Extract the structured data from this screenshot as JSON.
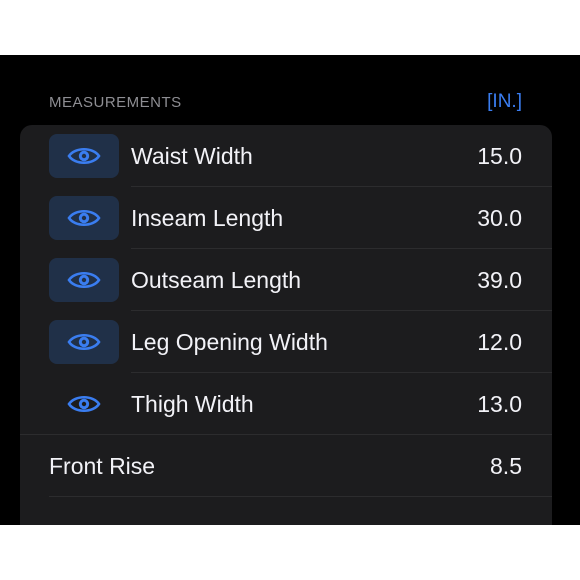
{
  "section": {
    "title": "MEASUREMENTS",
    "unit_label": "[IN.]"
  },
  "colors": {
    "accent": "#3a7df0",
    "card_bg": "#1c1c1e",
    "eye_box_bg": "#203048",
    "separator": "#2c2c2e"
  },
  "rows": [
    {
      "label": "Waist Width",
      "value": "15.0",
      "icon": "eye-icon",
      "highlighted": true
    },
    {
      "label": "Inseam Length",
      "value": "30.0",
      "icon": "eye-icon",
      "highlighted": true
    },
    {
      "label": "Outseam Length",
      "value": "39.0",
      "icon": "eye-icon",
      "highlighted": true
    },
    {
      "label": "Leg Opening Width",
      "value": "12.0",
      "icon": "eye-icon",
      "highlighted": true
    },
    {
      "label": "Thigh Width",
      "value": "13.0",
      "icon": "eye-icon",
      "highlighted": false
    },
    {
      "label": "Front Rise",
      "value": "8.5"
    }
  ]
}
